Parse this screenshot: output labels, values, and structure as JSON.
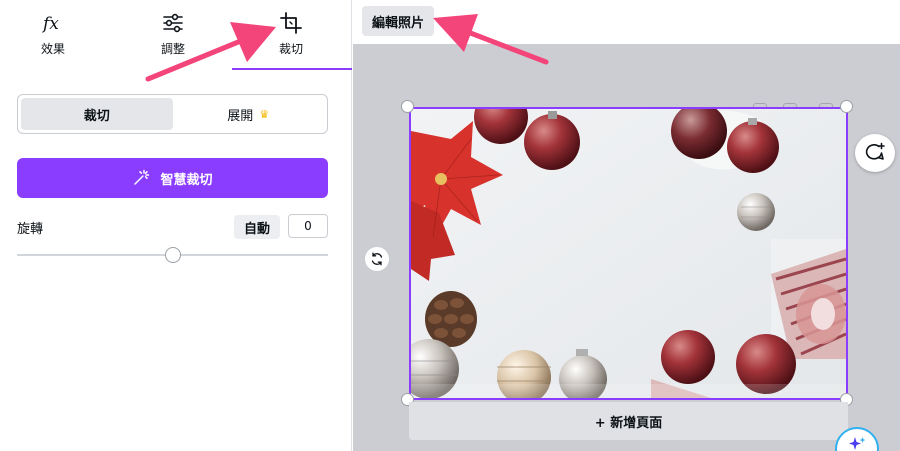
{
  "tool_tabs": {
    "effects": {
      "label": "效果",
      "icon": "fx-icon"
    },
    "adjust": {
      "label": "調整",
      "icon": "sliders-icon"
    },
    "crop": {
      "label": "裁切",
      "icon": "crop-icon",
      "active": true
    }
  },
  "crop_mode": {
    "crop_label": "裁切",
    "expand_label": "展開",
    "expand_badge_icon": "crown-icon"
  },
  "smart_crop": {
    "label": "智慧裁切",
    "icon": "magic-wand-icon"
  },
  "rotate": {
    "label": "旋轉",
    "auto_label": "自動",
    "value": "0",
    "slider_fraction": 0.5
  },
  "canvas": {
    "edit_photo_label": "編輯照片",
    "add_page_label": "+ 新增頁面"
  },
  "colors": {
    "accent": "#8b3dff",
    "annotation_arrow": "#f4457a",
    "magic_ring": "#2fb0f0"
  }
}
